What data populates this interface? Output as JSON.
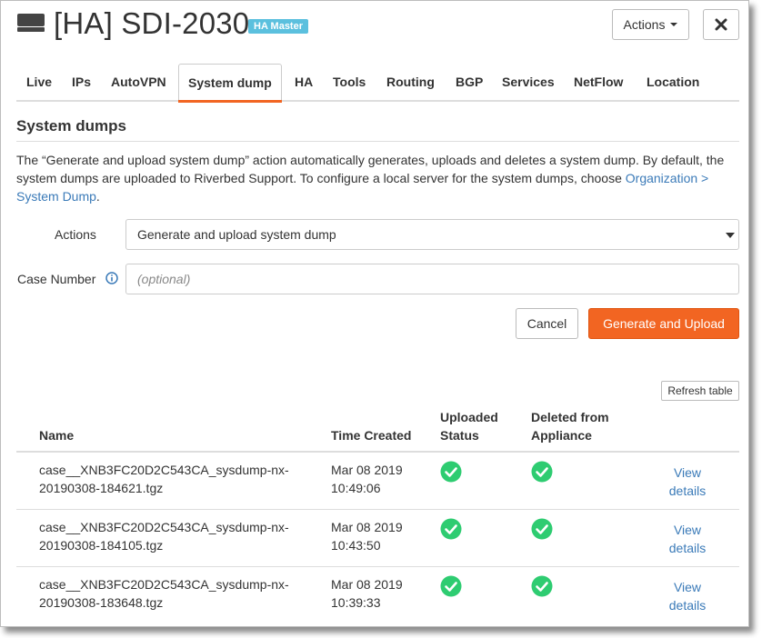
{
  "header": {
    "title": "[HA] SDI-2030",
    "badge": "HA Master",
    "actions_label": "Actions"
  },
  "tabs": [
    {
      "label": "Live"
    },
    {
      "label": "IPs"
    },
    {
      "label": "AutoVPN"
    },
    {
      "label": "System dump",
      "active": true
    },
    {
      "label": "HA"
    },
    {
      "label": "Tools"
    },
    {
      "label": "Routing"
    },
    {
      "label": "BGP"
    },
    {
      "label": "Services"
    },
    {
      "label": "NetFlow"
    },
    {
      "label": "Location"
    }
  ],
  "section": {
    "title": "System dumps",
    "description": "The “Generate and upload system dump” action automatically generates, uploads and deletes a system dump. By default, the system dumps are uploaded to Riverbed Support. To configure a local server for the system dumps, choose ",
    "link": "Organization > System Dump",
    "description_end": "."
  },
  "form": {
    "actions_label": "Actions",
    "actions_value": "Generate and upload system dump",
    "case_label": "Case Number",
    "case_placeholder": "(optional)",
    "cancel_label": "Cancel",
    "generate_label": "Generate and Upload"
  },
  "table": {
    "refresh_label": "Refresh table",
    "columns": {
      "name": "Name",
      "time": "Time Created",
      "uploaded_1": "Uploaded",
      "uploaded_2": "Status",
      "deleted_1": "Deleted from",
      "deleted_2": "Appliance"
    },
    "view_1": "View",
    "view_2": "details",
    "rows": [
      {
        "name_1": "case__XNB3FC20D2C543CA_sysdump-nx-",
        "name_2": "20190308-184621.tgz",
        "date": "Mar 08 2019",
        "time": "10:49:06"
      },
      {
        "name_1": "case__XNB3FC20D2C543CA_sysdump-nx-",
        "name_2": "20190308-184105.tgz",
        "date": "Mar 08 2019",
        "time": "10:43:50"
      },
      {
        "name_1": "case__XNB3FC20D2C543CA_sysdump-nx-",
        "name_2": "20190308-183648.tgz",
        "date": "Mar 08 2019",
        "time": "10:39:33"
      }
    ]
  },
  "colors": {
    "accent": "#f26522",
    "badge": "#5bc0de",
    "link": "#3a7ab8",
    "success": "#2ecc71"
  },
  "icons": {
    "device": "appliance-icon",
    "close": "close-icon",
    "info": "info-icon",
    "check": "check-circle-icon"
  }
}
